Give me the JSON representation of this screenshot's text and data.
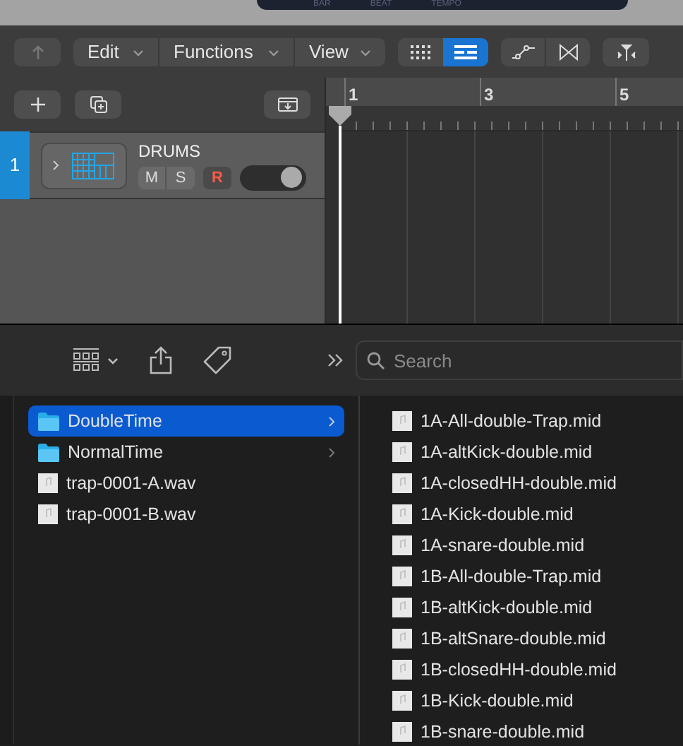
{
  "display": {
    "labels": [
      "BAR",
      "BEAT",
      "TEMPO"
    ]
  },
  "toolbar": {
    "menus": [
      {
        "label": "Edit"
      },
      {
        "label": "Functions"
      },
      {
        "label": "View"
      }
    ],
    "view_toggle": [
      {
        "kind": "grid",
        "selected": false
      },
      {
        "kind": "list",
        "selected": true
      }
    ]
  },
  "ruler": {
    "marks": [
      "1",
      "3",
      "5"
    ]
  },
  "tracks": [
    {
      "number": "1",
      "name": "DRUMS",
      "selected": true,
      "mute": "M",
      "solo": "S",
      "record": "R",
      "on": true
    }
  ],
  "browser": {
    "search": {
      "placeholder": "Search"
    },
    "columns": [
      {
        "items": [
          {
            "kind": "folder",
            "name": "DoubleTime",
            "selected": true
          },
          {
            "kind": "folder",
            "name": "NormalTime",
            "selected": false
          },
          {
            "kind": "file",
            "name": "trap-0001-A.wav",
            "selected": false
          },
          {
            "kind": "file",
            "name": "trap-0001-B.wav",
            "selected": false
          }
        ]
      },
      {
        "items": [
          {
            "kind": "file",
            "name": "1A-All-double-Trap.mid",
            "selected": false
          },
          {
            "kind": "file",
            "name": "1A-altKick-double.mid",
            "selected": false
          },
          {
            "kind": "file",
            "name": "1A-closedHH-double.mid",
            "selected": false
          },
          {
            "kind": "file",
            "name": "1A-Kick-double.mid",
            "selected": false
          },
          {
            "kind": "file",
            "name": "1A-snare-double.mid",
            "selected": false
          },
          {
            "kind": "file",
            "name": "1B-All-double-Trap.mid",
            "selected": false
          },
          {
            "kind": "file",
            "name": "1B-altKick-double.mid",
            "selected": false
          },
          {
            "kind": "file",
            "name": "1B-altSnare-double.mid",
            "selected": false
          },
          {
            "kind": "file",
            "name": "1B-closedHH-double.mid",
            "selected": false
          },
          {
            "kind": "file",
            "name": "1B-Kick-double.mid",
            "selected": false
          },
          {
            "kind": "file",
            "name": "1B-snare-double.mid",
            "selected": false
          }
        ]
      }
    ]
  }
}
